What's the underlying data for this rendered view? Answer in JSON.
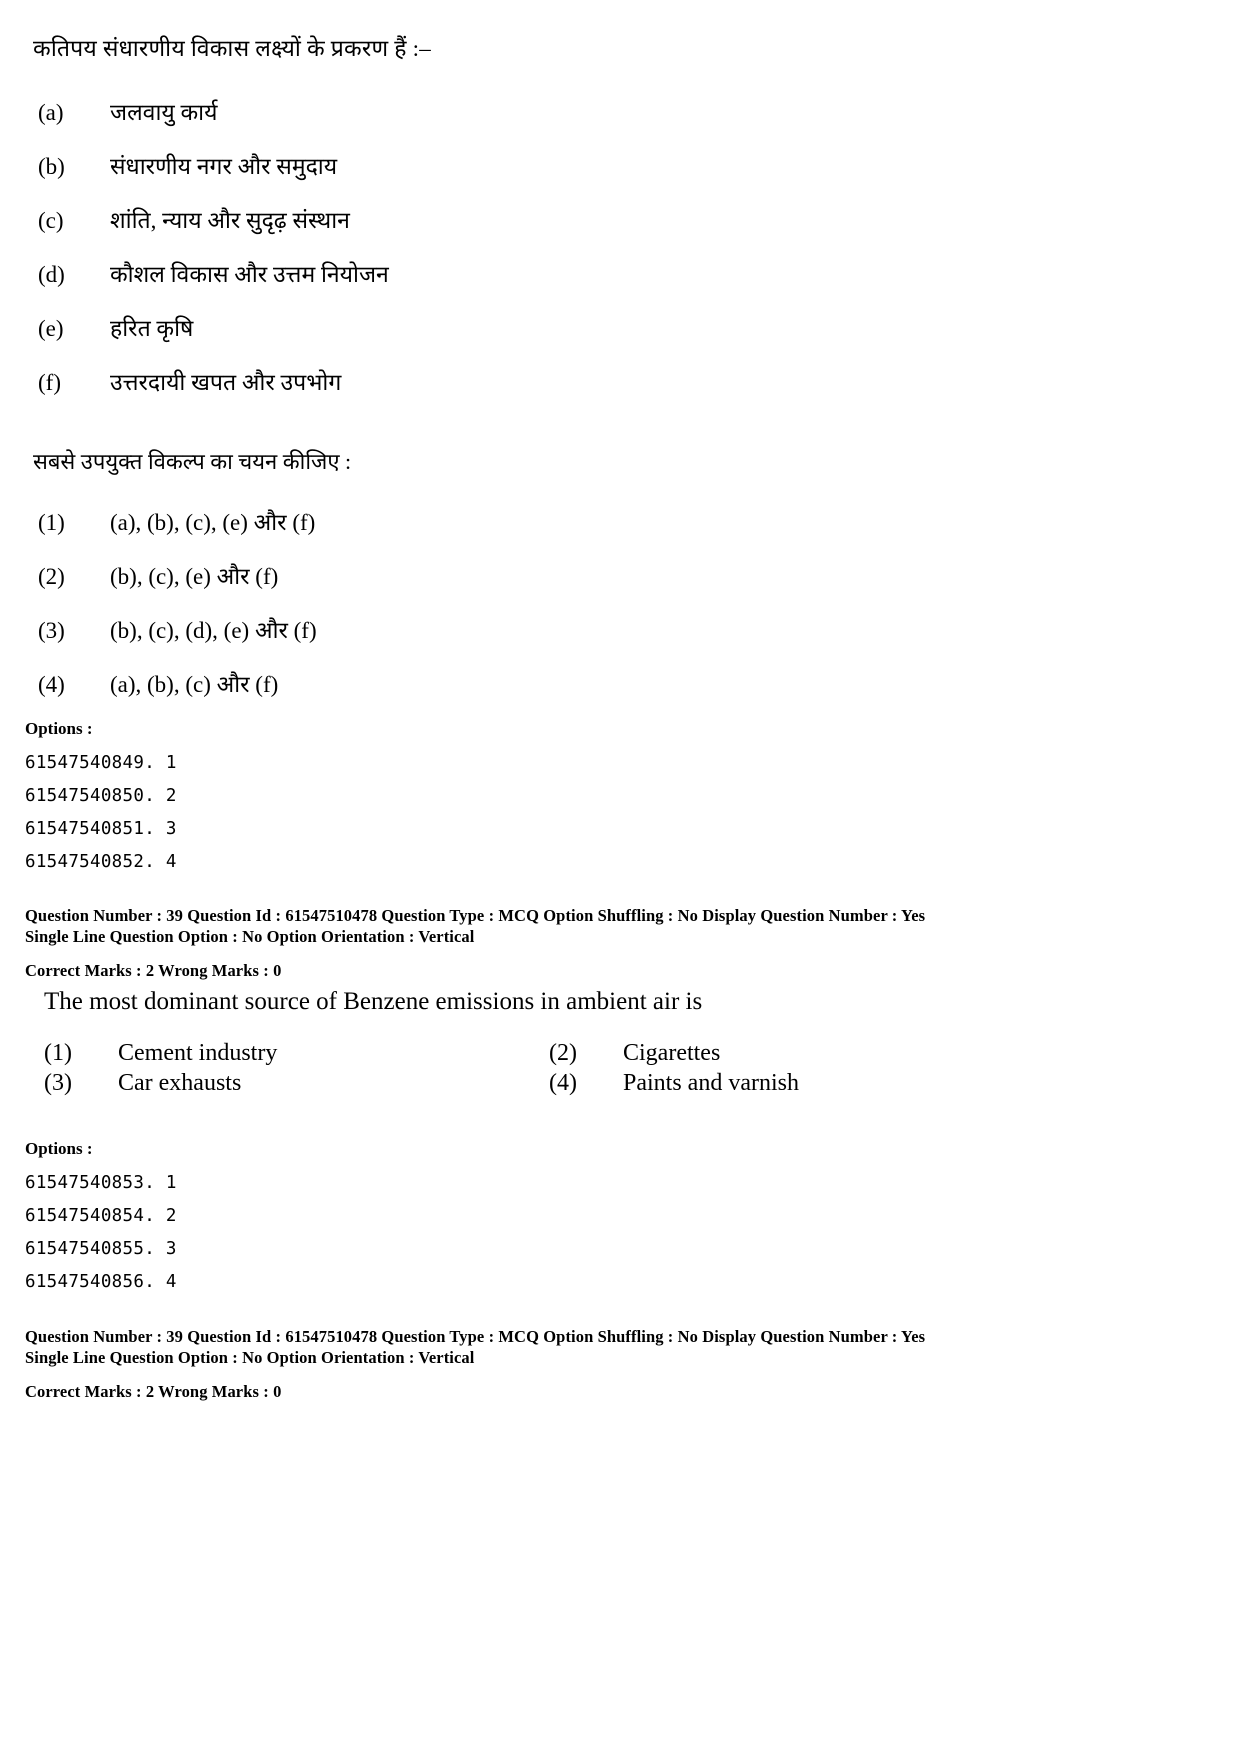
{
  "question_hindi": {
    "stem": "कतिपय संधारणीय विकास लक्ष्यों के प्रकरण हैं :–",
    "sub_items": [
      {
        "label": "(a)",
        "text": "जलवायु कार्य"
      },
      {
        "label": "(b)",
        "text": "संधारणीय नगर और समुदाय"
      },
      {
        "label": "(c)",
        "text": "शांति, न्याय और सुदृढ़ संस्थान"
      },
      {
        "label": "(d)",
        "text": "कौशल विकास और उत्तम नियोजन"
      },
      {
        "label": "(e)",
        "text": "हरित कृषि"
      },
      {
        "label": "(f)",
        "text": "उत्तरदायी खपत और उपभोग"
      }
    ],
    "instruction": "सबसे उपयुक्त विकल्प का चयन कीजिए :",
    "choices": [
      {
        "num": "(1)",
        "text": "(a), (b), (c), (e) और (f)"
      },
      {
        "num": "(2)",
        "text": "(b), (c), (e) और (f)"
      },
      {
        "num": "(3)",
        "text": "(b), (c), (d), (e) और (f)"
      },
      {
        "num": "(4)",
        "text": "(a), (b), (c) और (f)"
      }
    ],
    "options_heading": "Options :",
    "option_ids": [
      "61547540849. 1",
      "61547540850. 2",
      "61547540851. 3",
      "61547540852. 4"
    ],
    "meta": {
      "line1": "Question Number : 39  Question Id : 61547510478  Question Type : MCQ  Option Shuffling : No  Display Question Number : Yes",
      "line2": "Single Line Question Option : No  Option Orientation : Vertical",
      "line3": "Correct Marks : 2  Wrong Marks : 0"
    }
  },
  "question_english": {
    "stem": "The most dominant source of Benzene emissions in ambient air is",
    "choices": [
      {
        "num": "(1)",
        "text": "Cement industry"
      },
      {
        "num": "(2)",
        "text": "Cigarettes"
      },
      {
        "num": "(3)",
        "text": "Car exhausts"
      },
      {
        "num": "(4)",
        "text": "Paints and varnish"
      }
    ],
    "options_heading": "Options :",
    "option_ids": [
      "61547540853. 1",
      "61547540854. 2",
      "61547540855. 3",
      "61547540856. 4"
    ],
    "meta": {
      "line1": "Question Number : 39  Question Id : 61547510478  Question Type : MCQ  Option Shuffling : No  Display Question Number : Yes",
      "line2": "Single Line Question Option : No  Option Orientation : Vertical",
      "line3": "Correct Marks : 2  Wrong Marks : 0"
    }
  }
}
